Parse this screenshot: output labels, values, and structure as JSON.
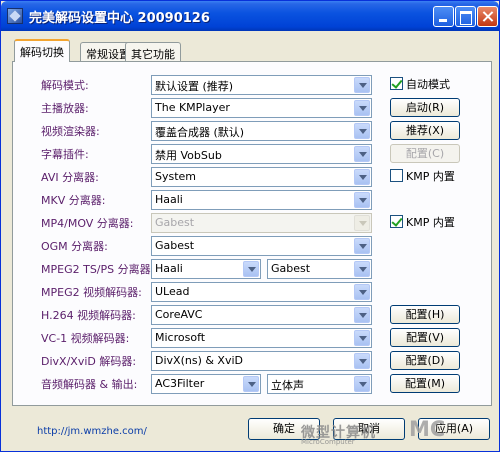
{
  "window": {
    "title": "完美解码设置中心  20090126"
  },
  "tabs": [
    {
      "label": "解码切换",
      "active": true
    },
    {
      "label": "常规设置",
      "active": false
    },
    {
      "label": "其它功能",
      "active": false
    }
  ],
  "rows": [
    {
      "label": "解码模式:",
      "value": "默认设置 (推荐)",
      "side": {
        "kind": "checkbox",
        "label": "自动模式",
        "checked": true
      }
    },
    {
      "label": "主播放器:",
      "value": "The KMPlayer",
      "side": {
        "kind": "button",
        "label": "启动(R)"
      }
    },
    {
      "label": "视频渲染器:",
      "value": "覆盖合成器 (默认)",
      "side": {
        "kind": "button",
        "label": "推荐(X)"
      }
    },
    {
      "label": "字幕插件:",
      "value": "禁用 VobSub",
      "side": {
        "kind": "button",
        "label": "配置(C)",
        "disabled": true
      }
    },
    {
      "label": "AVI 分离器:",
      "value": "System",
      "side": {
        "kind": "checkbox",
        "label": "KMP 内置",
        "checked": false
      }
    },
    {
      "label": "MKV 分离器:",
      "value": "Haali"
    },
    {
      "label": "MP4/MOV 分离器:",
      "value": "Gabest",
      "disabled": true,
      "side": {
        "kind": "checkbox",
        "label": "KMP 内置",
        "checked": true
      }
    },
    {
      "label": "OGM 分离器:",
      "value": "Gabest"
    },
    {
      "label": "MPEG2 TS/PS 分离器:",
      "value": "Haali",
      "value2": "Gabest"
    },
    {
      "label": "MPEG2 视频解码器:",
      "value": "ULead"
    },
    {
      "label": "H.264 视频解码器:",
      "value": "CoreAVC",
      "side": {
        "kind": "button",
        "label": "配置(H)"
      }
    },
    {
      "label": "VC-1 视频解码器:",
      "value": "Microsoft",
      "side": {
        "kind": "button",
        "label": "配置(V)"
      }
    },
    {
      "label": "DivX/XviD 解码器:",
      "value": "DivX(ns) & XviD",
      "side": {
        "kind": "button",
        "label": "配置(D)"
      }
    },
    {
      "label": "音频解码器 & 输出:",
      "value": "AC3Filter",
      "value2": "立体声",
      "side": {
        "kind": "button",
        "label": "配置(M)"
      }
    }
  ],
  "footer": {
    "link": "http://jm.wmzhe.com/",
    "ok": "确定",
    "cancel": "取消",
    "apply": "应用(A)"
  },
  "watermark": {
    "cn": "微型计算机",
    "en": "MicroComputer",
    "mark": "MC"
  },
  "colors": {
    "title_bar": "#0a53e0",
    "label_text": "#5a1e6a",
    "panel_bg": "#fcfcfe",
    "window_bg": "#ece9d8"
  }
}
